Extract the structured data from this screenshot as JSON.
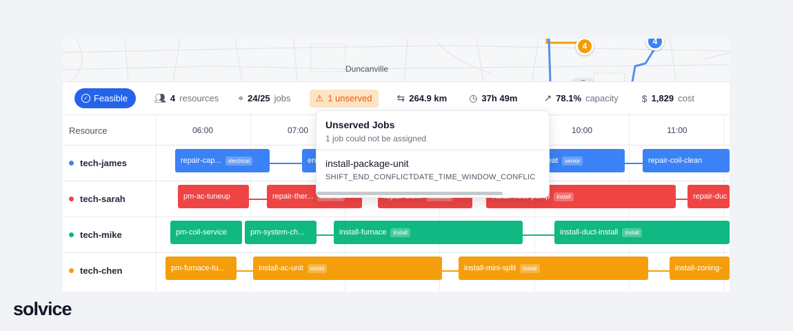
{
  "map": {
    "label": "Duncanville",
    "markers": [
      "4",
      "4"
    ],
    "handle_glyph": "⠿"
  },
  "stats": {
    "status": "Feasible",
    "resources_value": "4",
    "resources_label": "resources",
    "jobs_value": "24/25",
    "jobs_label": "jobs",
    "unserved": "1 unserved",
    "distance": "264.9 km",
    "duration": "37h 49m",
    "capacity_value": "78.1%",
    "capacity_label": "capacity",
    "cost_value": "1,829",
    "cost_label": "cost"
  },
  "timeline": {
    "resource_header": "Resource",
    "hours": [
      "06:00",
      "07:00",
      "10:00",
      "11:00"
    ],
    "rows": [
      {
        "name": "tech-james",
        "color": "#3b82f6",
        "jobs": [
          {
            "label": "repair-cap...",
            "tag": "electrical"
          },
          {
            "label": "en",
            "tag": ""
          },
          {
            "label": "eat",
            "tag": "senior"
          },
          {
            "label": "repair-coil-clean",
            "tag": ""
          }
        ]
      },
      {
        "name": "tech-sarah",
        "color": "#ef4444",
        "jobs": [
          {
            "label": "pm-ac-tuneup",
            "tag": ""
          },
          {
            "label": "repair-ther...",
            "tag": "electrical"
          },
          {
            "label": "repair-blo...",
            "tag": "electrical"
          },
          {
            "label": "install-heat-pump",
            "tag": "install"
          },
          {
            "label": "repair-duc",
            "tag": ""
          }
        ]
      },
      {
        "name": "tech-mike",
        "color": "#10b981",
        "jobs": [
          {
            "label": "pm-coil-service",
            "tag": ""
          },
          {
            "label": "pm-system-ch...",
            "tag": ""
          },
          {
            "label": "install-furnace",
            "tag": "install"
          },
          {
            "label": "install-duct-install",
            "tag": "install"
          }
        ]
      },
      {
        "name": "tech-chen",
        "color": "#f59e0b",
        "jobs": [
          {
            "label": "pm-furnace-tu...",
            "tag": ""
          },
          {
            "label": "install-ac-unit",
            "tag": "install"
          },
          {
            "label": "install-mini-split",
            "tag": "install"
          },
          {
            "label": "install-zoning-",
            "tag": ""
          }
        ]
      }
    ]
  },
  "popup": {
    "title": "Unserved Jobs",
    "subtitle": "1 job could not be assigned",
    "job": "install-package-unit",
    "reason": "SHIFT_END_CONFLICTDATE_TIME_WINDOW_CONFLIC"
  },
  "brand": "solvice"
}
